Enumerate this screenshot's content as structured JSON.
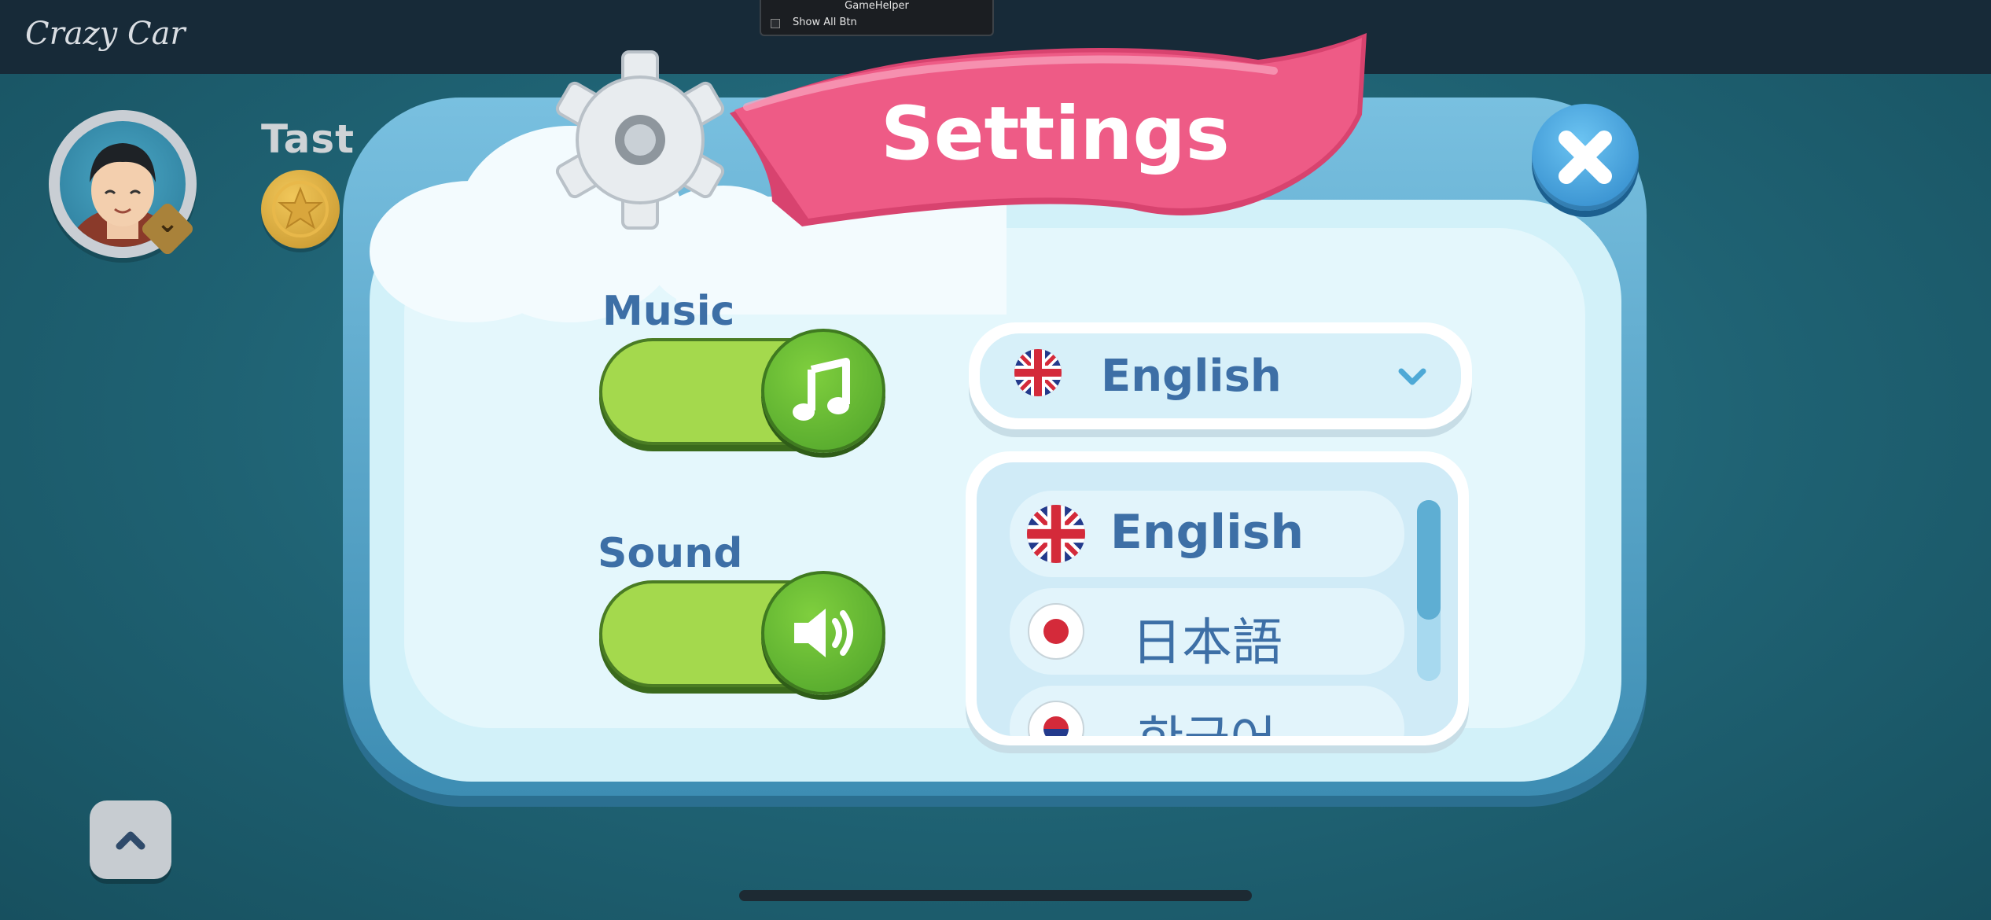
{
  "app": {
    "title": "Crazy Car"
  },
  "game_helper": {
    "title": "GameHelper",
    "checkbox_label": "Show All Btn"
  },
  "player": {
    "name": "Tast"
  },
  "settings": {
    "title": "Settings",
    "music_label": "Music",
    "sound_label": "Sound",
    "music_enabled": true,
    "sound_enabled": true,
    "selected_language": "English",
    "language_options": [
      "English",
      "日本語",
      "한국어"
    ]
  },
  "colors": {
    "ribbon": "#ee5b86",
    "toggle_on": "#a4d94d",
    "close_button": "#2b84c7",
    "label_text": "#3d6fa6"
  },
  "icons": {
    "close": "close-icon",
    "music": "music-note-icon",
    "sound": "speaker-icon",
    "dropdown": "chevron-down-icon",
    "up": "chevron-up-icon",
    "gear": "gear-icon"
  }
}
